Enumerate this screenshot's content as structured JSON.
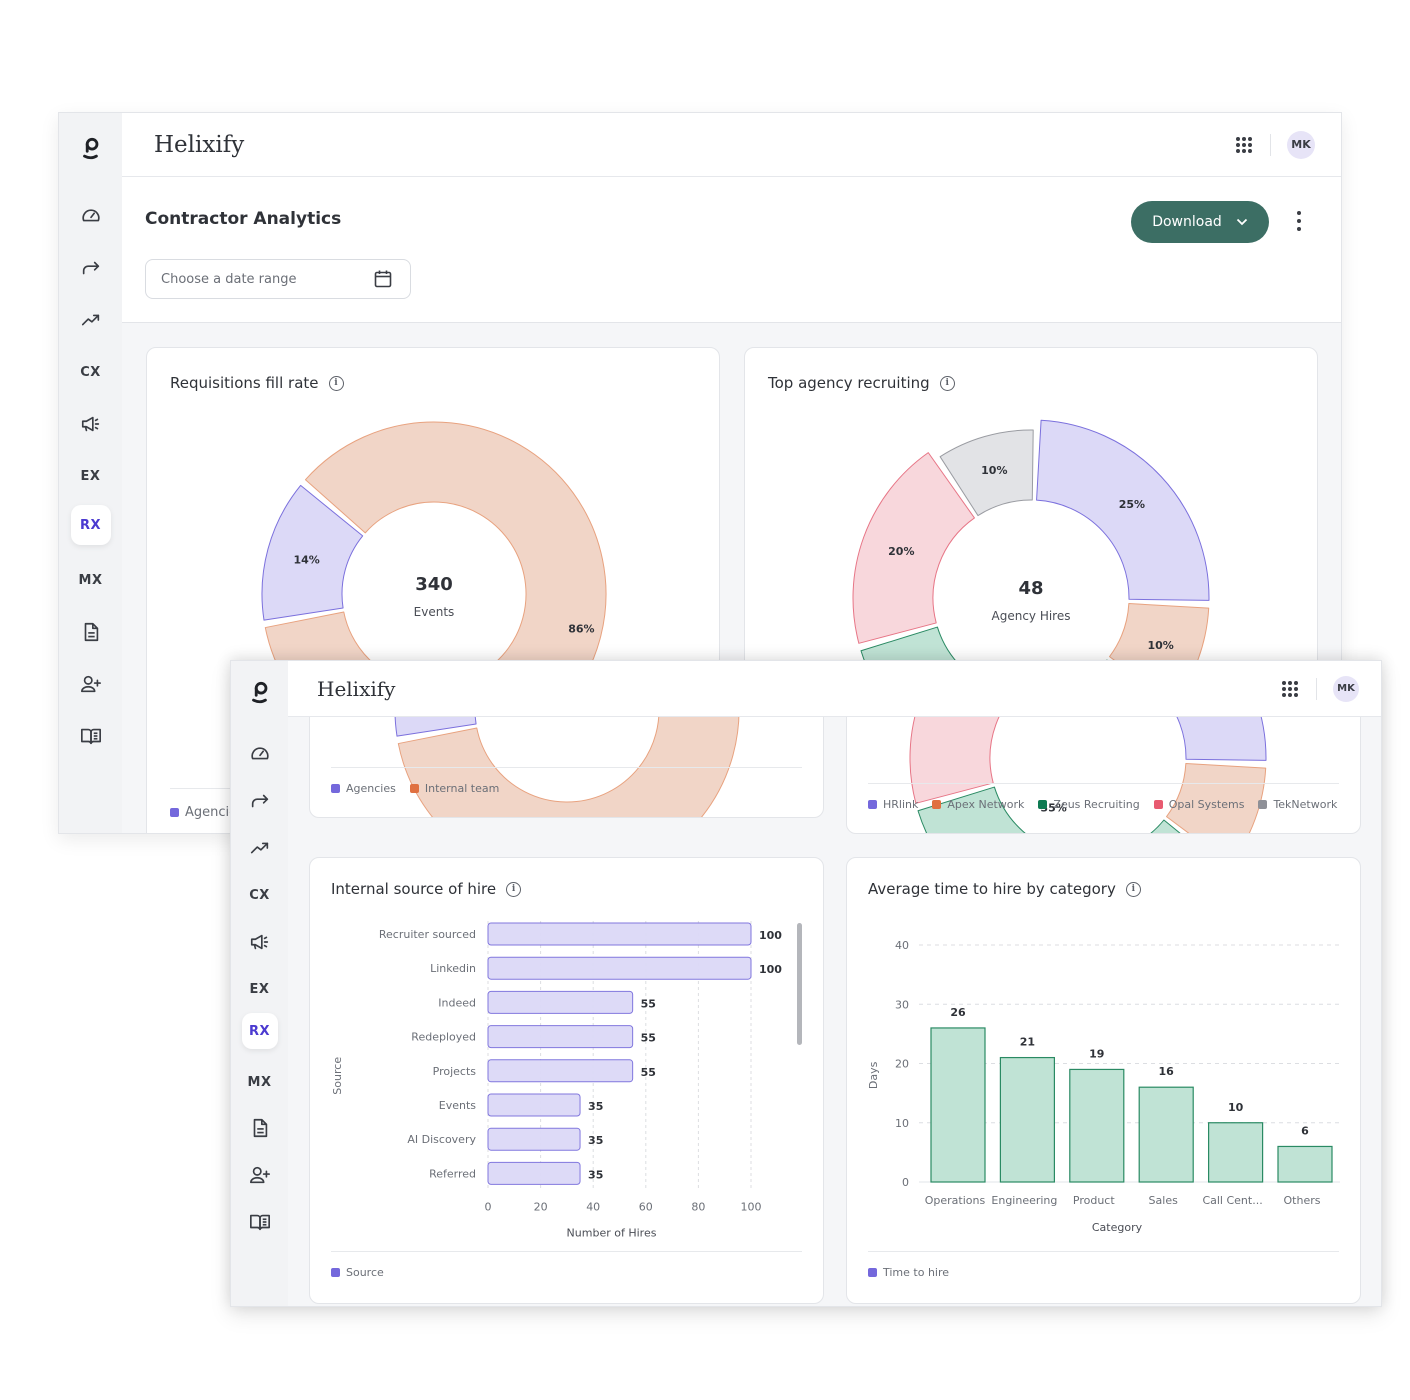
{
  "app": {
    "brand": "Helixify",
    "user_initials": "MK"
  },
  "sidebar": {
    "items": [
      {
        "id": "logo",
        "type": "logo",
        "icon": "brand-logo-icon"
      },
      {
        "id": "dashboard",
        "type": "icon",
        "icon": "speedometer-icon"
      },
      {
        "id": "forward",
        "type": "icon",
        "icon": "forward-arrow-icon"
      },
      {
        "id": "trending",
        "type": "icon",
        "icon": "trending-up-icon"
      },
      {
        "id": "cx",
        "type": "text",
        "label": "CX"
      },
      {
        "id": "campaigns",
        "type": "icon",
        "icon": "megaphone-icon"
      },
      {
        "id": "ex",
        "type": "text",
        "label": "EX"
      },
      {
        "id": "rx",
        "type": "text",
        "label": "RX",
        "active": true
      },
      {
        "id": "mx",
        "type": "text",
        "label": "MX"
      },
      {
        "id": "documents",
        "type": "icon",
        "icon": "document-icon"
      },
      {
        "id": "add-user",
        "type": "icon",
        "icon": "user-add-icon"
      },
      {
        "id": "library",
        "type": "icon",
        "icon": "book-icon"
      }
    ]
  },
  "page": {
    "title": "Contractor Analytics",
    "date_range_placeholder": "Choose a date range",
    "download_label": "Download",
    "more_icon": "kebab-vertical-icon",
    "calendar_icon": "calendar-icon",
    "apps_icon": "apps-grid-icon"
  },
  "colors": {
    "accent": "#3c6e64",
    "active_nav": "#4b3ad0",
    "purple_fill": "#dcd9f7",
    "purple_stroke": "#7b70dd",
    "purple_legend": "#7468dc",
    "peach_fill": "#f1d5c7",
    "peach_stroke": "#e8a27f",
    "orange_legend": "#e07040",
    "green_fill": "#c0e3d5",
    "green_stroke": "#2a8a63",
    "green_legend": "#0e7a52",
    "pink_fill": "#f8d7dc",
    "pink_stroke": "#e77586",
    "pink_legend": "#e85a70",
    "gray_fill": "#e2e3e6",
    "gray_stroke": "#9a9ca2",
    "gray_legend": "#8e9097"
  },
  "chart_data": [
    {
      "id": "requisitions_fill_rate",
      "type": "pie",
      "title": "Requisitions fill rate",
      "center_value": "340",
      "center_label": "Events",
      "slices": [
        {
          "name": "Agencies",
          "value": 14,
          "label": "14%"
        },
        {
          "name": "Internal team",
          "value": 86,
          "label": "86%"
        }
      ],
      "legend": [
        "Agencies",
        "Internal team"
      ],
      "legend_position": "bottom-left"
    },
    {
      "id": "top_agency_recruiting",
      "type": "pie",
      "title": "Top agency recruiting",
      "center_value": "48",
      "center_label": "Agency Hires",
      "slices": [
        {
          "name": "HRlink",
          "value": 25,
          "label": "25%"
        },
        {
          "name": "Apex Network",
          "value": 10,
          "label": "10%"
        },
        {
          "name": "Zeus Recruiting",
          "value": 35,
          "label": "35%"
        },
        {
          "name": "Opal Systems",
          "value": 20,
          "label": "20%"
        },
        {
          "name": "TekNetwork",
          "value": 10,
          "label": "10%"
        }
      ],
      "legend": [
        "HRlink",
        "Apex Network",
        "Zeus Recruiting",
        "Opal Systems",
        "TekNetwork"
      ],
      "legend_position": "bottom-left"
    },
    {
      "id": "internal_source_of_hire",
      "type": "bar",
      "orientation": "horizontal",
      "title": "Internal source of hire",
      "categories": [
        "Recruiter sourced",
        "Linkedin",
        "Indeed",
        "Redeployed",
        "Projects",
        "Events",
        "AI Discovery",
        "Referred"
      ],
      "values": [
        100,
        100,
        55,
        55,
        55,
        35,
        35,
        35
      ],
      "xlabel": "Number of Hires",
      "ylabel": "Source",
      "xlim": [
        0,
        100
      ],
      "xticks": [
        0,
        20,
        40,
        60,
        80,
        100
      ],
      "grid": true,
      "legend": [
        "Source"
      ],
      "legend_position": "bottom-left"
    },
    {
      "id": "average_time_to_hire",
      "type": "bar",
      "orientation": "vertical",
      "title": "Average time to hire by category",
      "categories": [
        "Operations",
        "Engineering",
        "Product",
        "Sales",
        "Call Cent...",
        "Others"
      ],
      "values": [
        26,
        21,
        19,
        16,
        10,
        6
      ],
      "xlabel": "Category",
      "ylabel": "Days",
      "ylim": [
        0,
        40
      ],
      "yticks": [
        0,
        10,
        20,
        30,
        40
      ],
      "grid": true,
      "legend": [
        "Time to hire"
      ],
      "legend_position": "bottom-left"
    }
  ]
}
